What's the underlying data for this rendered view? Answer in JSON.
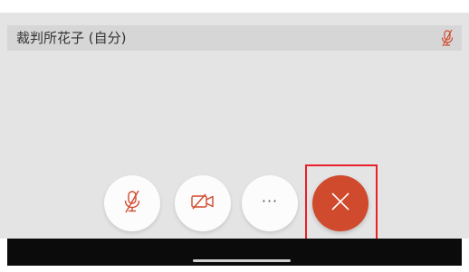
{
  "participant": {
    "name": "裁判所花子 (自分)",
    "mic_status_icon": "mic-muted-icon"
  },
  "controls": {
    "mute_icon": "mic-muted-icon",
    "video_icon": "video-off-icon",
    "more_label": "···",
    "hangup_icon": "close-icon"
  },
  "colors": {
    "accent": "#d04a2e",
    "highlight": "#e8202a",
    "video_area": "#e4e4e4",
    "name_bar": "#d6d6d6"
  }
}
